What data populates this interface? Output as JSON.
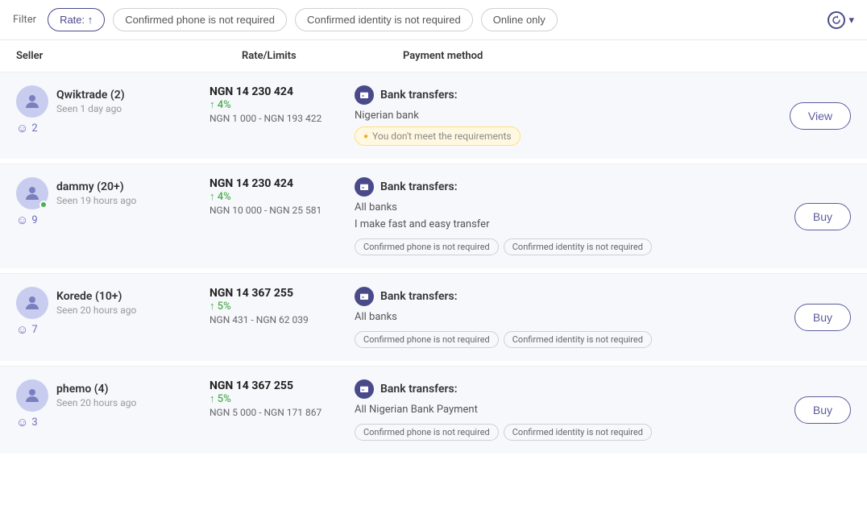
{
  "filterBar": {
    "filterLabel": "Filter",
    "rateBtn": "Rate: ↑",
    "phoneBtn": "Confirmed phone is not required",
    "identityBtn": "Confirmed identity is not required",
    "onlineBtn": "Online only",
    "refreshArrow": "▾"
  },
  "tableHeaders": {
    "seller": "Seller",
    "rateLimits": "Rate/Limits",
    "paymentMethod": "Payment method"
  },
  "rows": [
    {
      "seller": {
        "name": "Qwiktrade",
        "tradeCount": "(2)",
        "seen": "Seen 1 day ago",
        "rating": "2",
        "online": false
      },
      "rate": {
        "currency": "NGN",
        "amount": "14 230 424",
        "percent": "↑ 4%",
        "limitsMin": "NGN 1 000",
        "limitsMax": "NGN 193 422"
      },
      "payment": {
        "type": "Bank transfers:",
        "desc": "Nigerian bank",
        "warning": "You don't meet the requirements",
        "badges": []
      },
      "actionBtn": "View",
      "actionType": "view"
    },
    {
      "seller": {
        "name": "dammy",
        "tradeCount": "(20+)",
        "seen": "Seen 19 hours ago",
        "rating": "9",
        "online": true
      },
      "rate": {
        "currency": "NGN",
        "amount": "14 230 424",
        "percent": "↑ 4%",
        "limitsMin": "NGN 10 000",
        "limitsMax": "NGN 25 581"
      },
      "payment": {
        "type": "Bank transfers:",
        "desc": "All banks\nI make fast and easy transfer",
        "warning": "",
        "badges": [
          "Confirmed phone is not required",
          "Confirmed identity is not required"
        ]
      },
      "actionBtn": "Buy",
      "actionType": "buy"
    },
    {
      "seller": {
        "name": "Korede",
        "tradeCount": "(10+)",
        "seen": "Seen 20 hours ago",
        "rating": "7",
        "online": false
      },
      "rate": {
        "currency": "NGN",
        "amount": "14 367 255",
        "percent": "↑ 5%",
        "limitsMin": "NGN 431",
        "limitsMax": "NGN 62 039"
      },
      "payment": {
        "type": "Bank transfers:",
        "desc": "All banks",
        "warning": "",
        "badges": [
          "Confirmed phone is not required",
          "Confirmed identity is not required"
        ]
      },
      "actionBtn": "Buy",
      "actionType": "buy"
    },
    {
      "seller": {
        "name": "phemo",
        "tradeCount": "(4)",
        "seen": "Seen 20 hours ago",
        "rating": "3",
        "online": false
      },
      "rate": {
        "currency": "NGN",
        "amount": "14 367 255",
        "percent": "↑ 5%",
        "limitsMin": "NGN 5 000",
        "limitsMax": "NGN 171 867"
      },
      "payment": {
        "type": "Bank transfers:",
        "desc": "All Nigerian Bank Payment",
        "warning": "",
        "badges": [
          "Confirmed phone is not required",
          "Confirmed identity is not required"
        ]
      },
      "actionBtn": "Buy",
      "actionType": "buy"
    }
  ]
}
